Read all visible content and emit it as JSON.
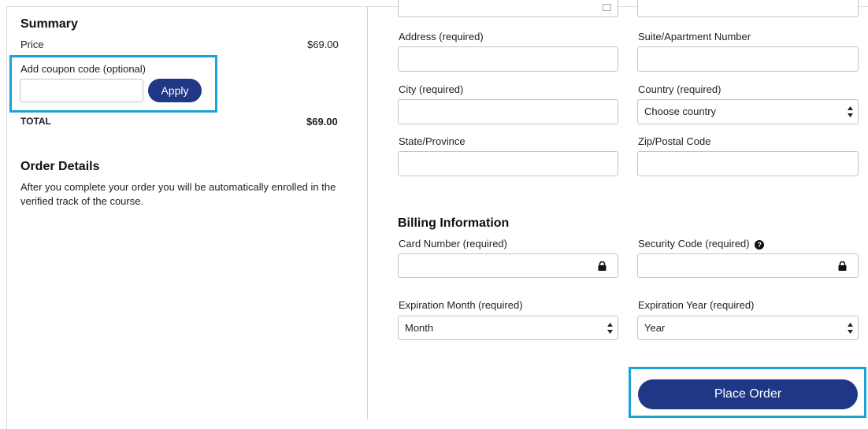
{
  "summary": {
    "heading": "Summary",
    "price_label": "Price",
    "price_value": "$69.00",
    "coupon_label": "Add coupon code (optional)",
    "apply_label": "Apply",
    "total_label": "TOTAL",
    "total_value": "$69.00"
  },
  "order_details": {
    "heading": "Order Details",
    "text_line1": "After you complete your order you will be automatically enrolled in the",
    "text_line2": "verified track of the course."
  },
  "address_form": {
    "address_label": "Address (required)",
    "suite_label": "Suite/Apartment Number",
    "city_label": "City (required)",
    "country_label": "Country (required)",
    "country_value": "Choose country",
    "state_label": "State/Province",
    "zip_label": "Zip/Postal Code"
  },
  "billing": {
    "heading": "Billing Information",
    "card_label": "Card Number (required)",
    "security_label": "Security Code (required)",
    "help_glyph": "?",
    "exp_month_label": "Expiration Month (required)",
    "exp_month_value": "Month",
    "exp_year_label": "Expiration Year (required)",
    "exp_year_value": "Year"
  },
  "actions": {
    "place_order_label": "Place Order"
  },
  "colors": {
    "primary_button": "#1f3784",
    "highlight": "#1aa3d9"
  },
  "icons": [
    "lock-icon",
    "help-circle-icon",
    "select-arrows-icon"
  ]
}
